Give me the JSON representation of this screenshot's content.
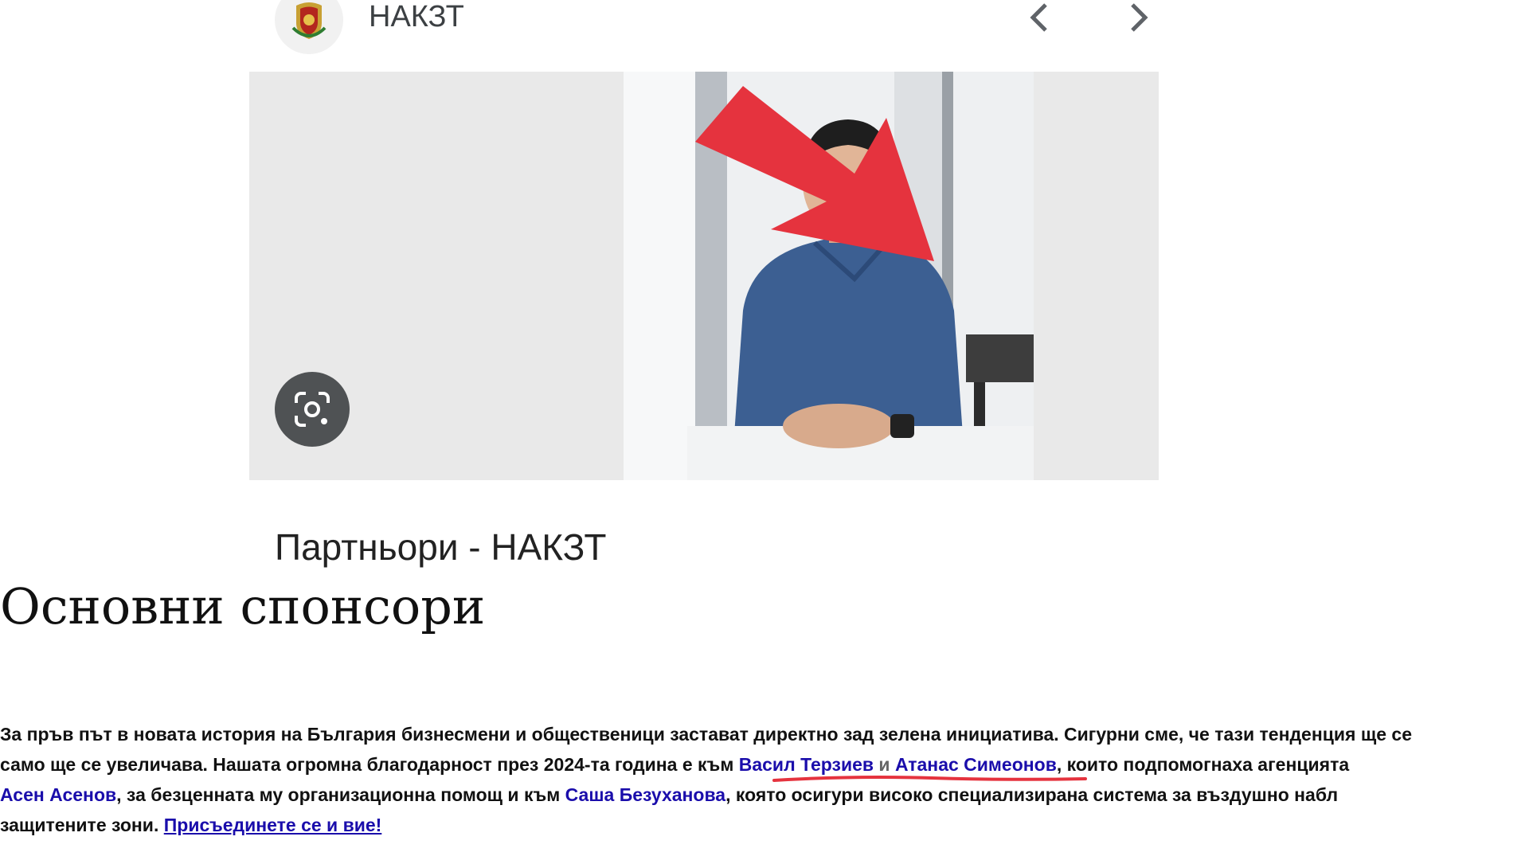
{
  "result": {
    "site_name": "НАКЗТ",
    "title": "Партньори - НАКЗТ"
  },
  "page": {
    "heading": "Основни спонсори"
  },
  "article": {
    "line1": "За пръв път в новата история на България бизнесмени и общественици застават директно зад зелена инициатива. Сигурни сме, че тази тенденция ще се",
    "line2_a": "само ще се увеличава. Нашата огромна благодарност през 2024-та година е към ",
    "link_terziev": "Васил Терзиев",
    "conj_and": " и ",
    "link_simeonov": "Атанас Симеонов",
    "line2_b": ", които подпомогнаха агенцията",
    "link_asenov": "Асен Асенов",
    "line3_a": ", за безценната му организационна помощ и към ",
    "link_bezuhanova": "Саша Безуханова",
    "line3_b": ", която осигури високо специализирана система за въздушно набл",
    "line4_a": "защитените зони. ",
    "link_join": "Присъединете се и вие!"
  },
  "icons": {
    "prev": "chevron-left-icon",
    "next": "chevron-right-icon",
    "lens": "google-lens-icon",
    "logo": "coat-of-arms-icon",
    "annotation": "red-arrow-annotation"
  },
  "colors": {
    "link": "#1a0dab",
    "annotation_red": "#e5333e",
    "lens_button": "#4f5254"
  }
}
